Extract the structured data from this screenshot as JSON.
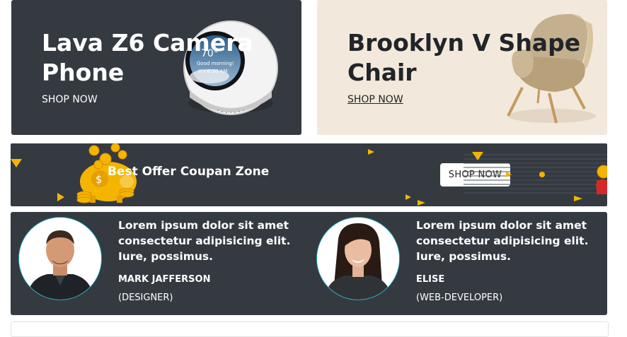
{
  "promos": [
    {
      "title": "Lava Z6 Camera Phone",
      "link": "SHOP NOW"
    },
    {
      "title": "Brooklyn V Shape Chair",
      "link": "SHOP NOW"
    }
  ],
  "coupon": {
    "text": "Best Offer Coupan Zone",
    "button": "SHOP NOW"
  },
  "testimonials": [
    {
      "quote": "Lorem ipsum dolor sit amet consectetur adipisicing elit. Iure, possimus.",
      "name": "MARK JAFFERSON",
      "role": "(DESIGNER)"
    },
    {
      "quote": "Lorem ipsum dolor sit amet consectetur adipisicing elit. Iure, possimus.",
      "name": "ELISE",
      "role": "(WEB-DEVELOPER)"
    }
  ],
  "echo_screen": {
    "temp": "70°",
    "greeting": "Good morning!",
    "time": "It's 6:30 AM"
  },
  "colors": {
    "dark": "#343a40",
    "cream": "#f2e8db",
    "accent": "#17a2b8",
    "gold": "#f4b400"
  }
}
